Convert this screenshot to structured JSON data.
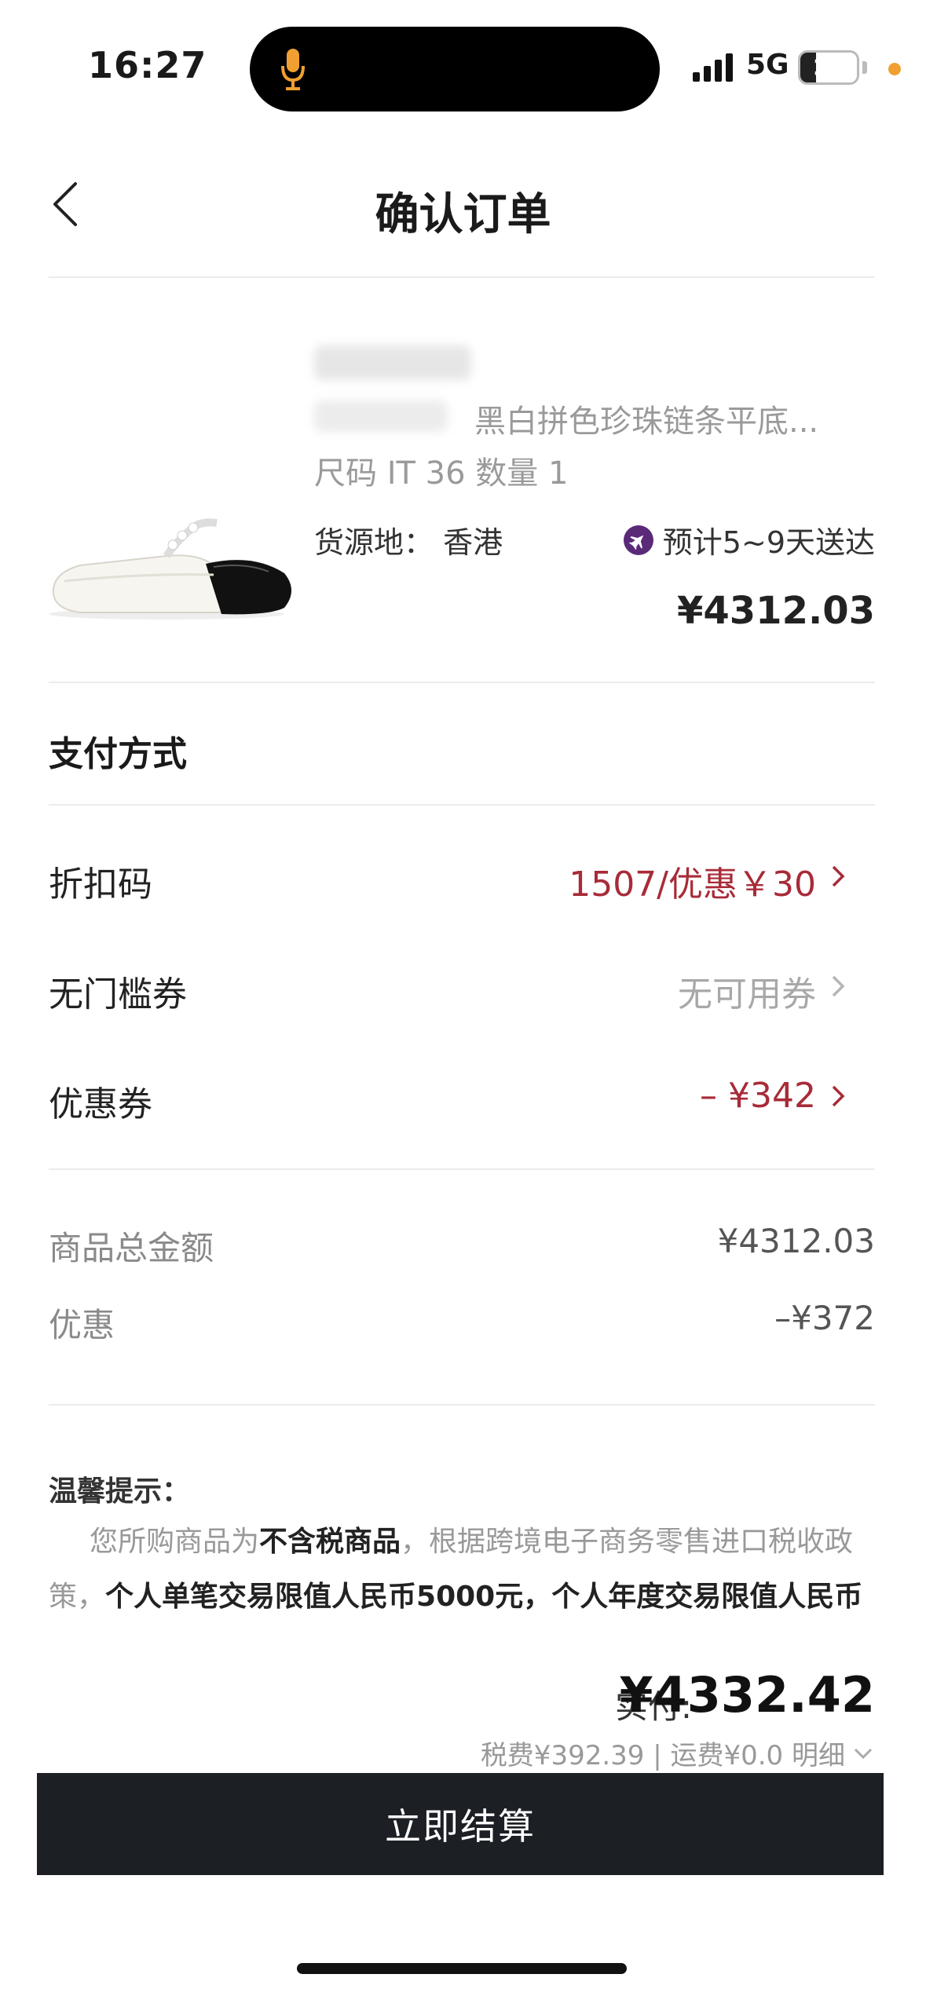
{
  "status_bar": {
    "time": "16:27",
    "network": "5G",
    "battery": "28",
    "battery_level": 0.28
  },
  "nav": {
    "title": "确认订单"
  },
  "product": {
    "name": "黑白拼色珍珠链条平底...",
    "size_qty": "尺码 IT 36 数量 1",
    "origin": "货源地： 香港",
    "delivery": "预计5~9天送达",
    "price": "¥4312.03"
  },
  "payment": {
    "title": "支付方式",
    "rows": [
      {
        "label": "折扣码",
        "value": "1507/优惠￥30"
      },
      {
        "label": "无门槛券",
        "value": "无可用券"
      },
      {
        "label": "优惠券",
        "value": "– ¥342"
      }
    ]
  },
  "summary": {
    "rows": [
      {
        "label": "商品总金额",
        "value": "¥4312.03"
      },
      {
        "label": "优惠",
        "value": "–¥372"
      }
    ]
  },
  "notice": {
    "title": "温馨提示：",
    "line1_a": "您所购商品为",
    "line1_b": "不含税商品",
    "line1_c": "，根据跨境电子商务零售进口税收政",
    "line2_a": "策，",
    "line2_b": "个人单笔交易限值人民币5000元，个人年度交易限值人民币"
  },
  "footer": {
    "pay_label": "实付:",
    "pay_amount": "¥4332.42",
    "fee_text": "税费¥392.39 | 运费¥0.0 明细",
    "checkout_label": "立即结算"
  },
  "colors": {
    "accent_red": "#a82b38",
    "button_dark": "#1c1f24",
    "icon_purple": "#5a2a78"
  }
}
